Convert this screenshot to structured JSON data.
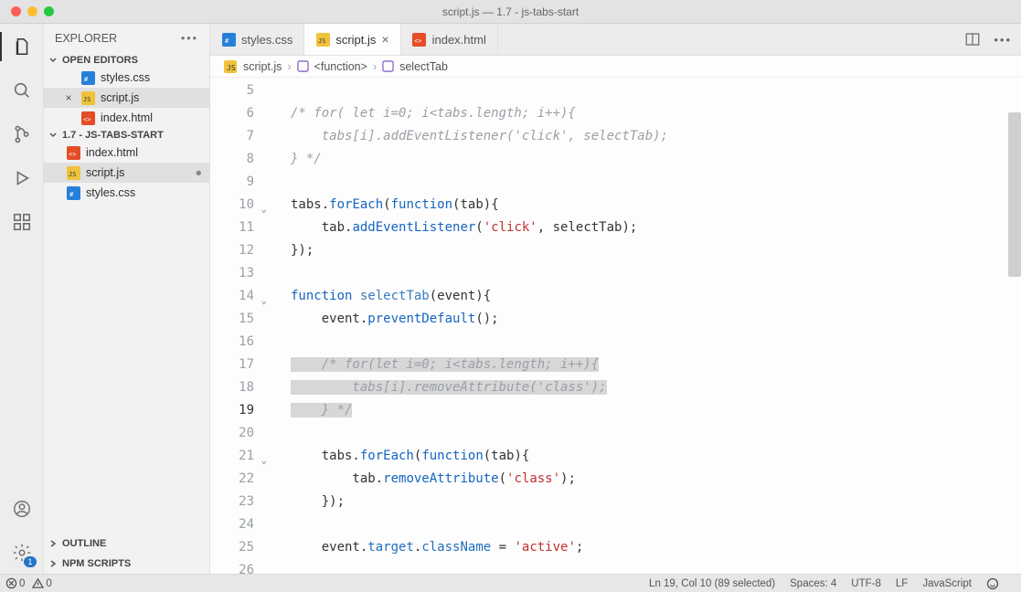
{
  "window": {
    "title": "script.js — 1.7 - js-tabs-start"
  },
  "sidebar": {
    "title": "EXPLORER",
    "open_editors_label": "OPEN EDITORS",
    "open_editors": [
      {
        "name": "styles.css",
        "type": "css",
        "active": false,
        "dirty": false
      },
      {
        "name": "script.js",
        "type": "js",
        "active": true,
        "dirty": false,
        "closeable": true
      },
      {
        "name": "index.html",
        "type": "html",
        "active": false,
        "dirty": false
      }
    ],
    "folder_label": "1.7 - JS-TABS-START",
    "folder_files": [
      {
        "name": "index.html",
        "type": "html"
      },
      {
        "name": "script.js",
        "type": "js",
        "active": true,
        "dirty": true
      },
      {
        "name": "styles.css",
        "type": "css"
      }
    ],
    "outline_label": "OUTLINE",
    "npm_label": "NPM SCRIPTS"
  },
  "tabs": [
    {
      "name": "styles.css",
      "type": "css",
      "active": false
    },
    {
      "name": "script.js",
      "type": "js",
      "active": true,
      "closeable": true
    },
    {
      "name": "index.html",
      "type": "html",
      "active": false
    }
  ],
  "breadcrumbs": {
    "file": "script.js",
    "scope": "<function>",
    "symbol": "selectTab"
  },
  "code": {
    "first_line": 5,
    "current_line": 19,
    "fold_lines": [
      10,
      14,
      21
    ],
    "dirty_line": 9,
    "lines": [
      "",
      "/* for( let i=0; i<tabs.length; i++){",
      "    tabs[i].addEventListener('click', selectTab);",
      "} */",
      "",
      "tabs.forEach(function(tab){",
      "    tab.addEventListener('click', selectTab);",
      "});",
      "",
      "function selectTab(event){",
      "    event.preventDefault();",
      "",
      "    /* for(let i=0; i<tabs.length; i++){",
      "        tabs[i].removeAttribute('class');",
      "    } */",
      "",
      "    tabs.forEach(function(tab){",
      "        tab.removeAttribute('class');",
      "    });",
      "",
      "    event.target.className = 'active';",
      ""
    ]
  },
  "statusbar": {
    "errors": "0",
    "warnings": "0",
    "cursor": "Ln 19, Col 10 (89 selected)",
    "spaces": "Spaces: 4",
    "encoding": "UTF-8",
    "eol": "LF",
    "lang": "JavaScript"
  },
  "settings_badge": "1"
}
